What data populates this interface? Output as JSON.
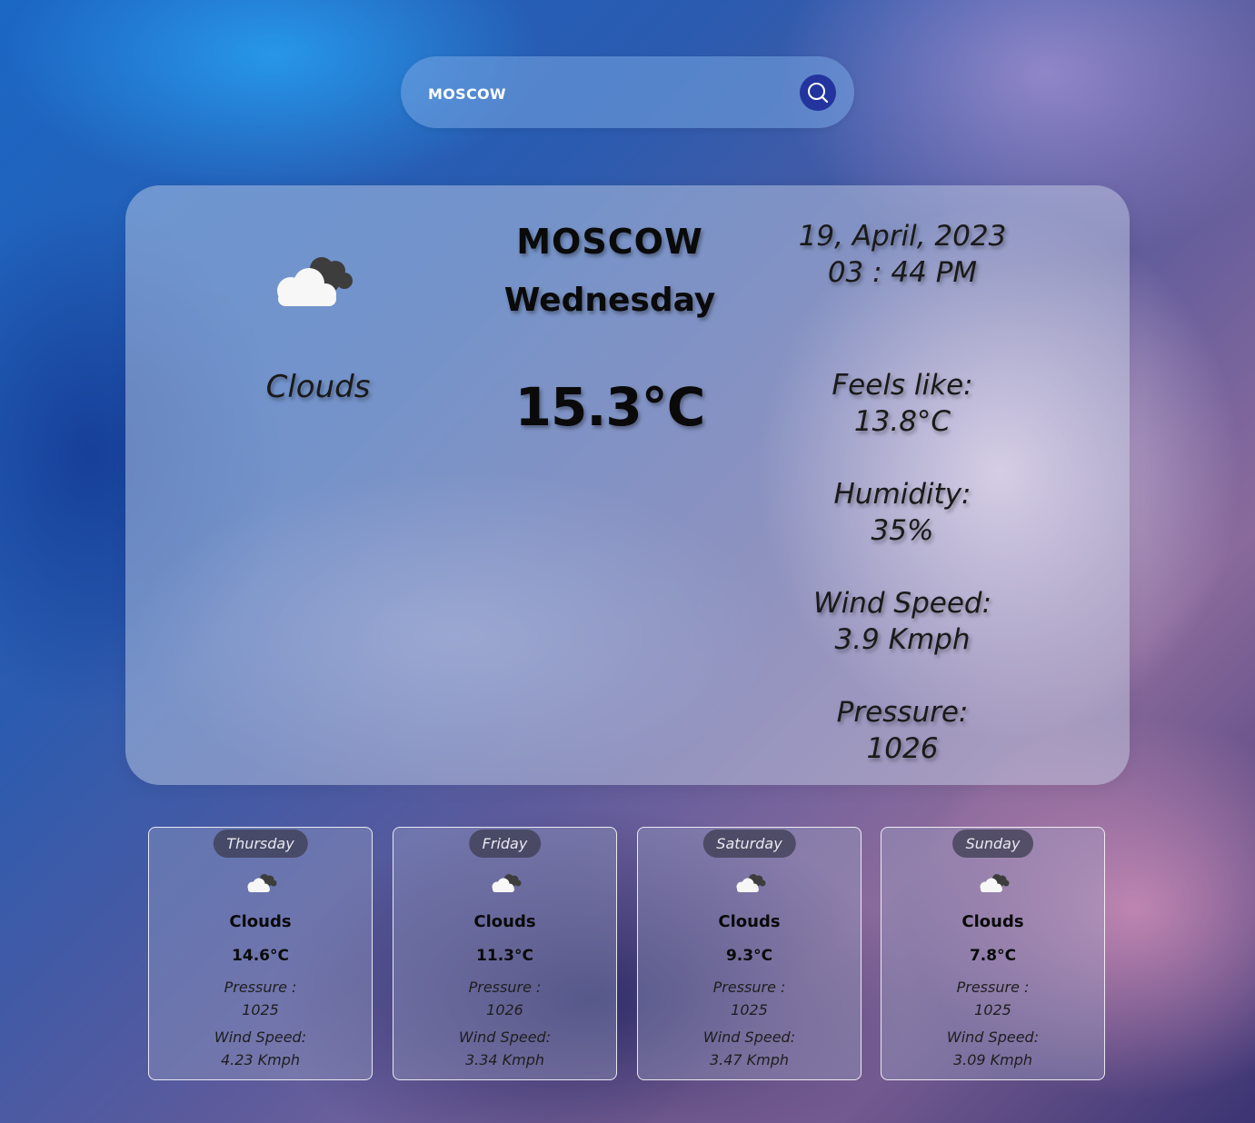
{
  "colors": {
    "search_bar_bg": "#78a5e1",
    "search_button": "#23349e",
    "text_dark": "#0a0a0a",
    "day_pill_bg": "#3c3c50"
  },
  "search": {
    "value": "MOSCOW",
    "placeholder": "Search city",
    "button_icon": "search-icon"
  },
  "current": {
    "icon": "clouds-icon",
    "condition": "Clouds",
    "city": "MOSCOW",
    "day": "Wednesday",
    "temperature": "15.3°C",
    "date": "19, April, 2023",
    "time": "03 : 44 PM",
    "stats": [
      {
        "label": "Feels like:",
        "value": "13.8°C"
      },
      {
        "label": "Humidity:",
        "value": "35%"
      },
      {
        "label": "Wind Speed:",
        "value": "3.9 Kmph"
      },
      {
        "label": "Pressure:",
        "value": "1026"
      }
    ]
  },
  "forecast": [
    {
      "day": "Thursday",
      "icon": "clouds-icon",
      "condition": "Clouds",
      "temperature": "14.6°C",
      "pressure_label": "Pressure :",
      "pressure": "1025",
      "wind_label": "Wind Speed:",
      "wind": "4.23 Kmph"
    },
    {
      "day": "Friday",
      "icon": "clouds-icon",
      "condition": "Clouds",
      "temperature": "11.3°C",
      "pressure_label": "Pressure :",
      "pressure": "1026",
      "wind_label": "Wind Speed:",
      "wind": "3.34 Kmph"
    },
    {
      "day": "Saturday",
      "icon": "clouds-icon",
      "condition": "Clouds",
      "temperature": "9.3°C",
      "pressure_label": "Pressure :",
      "pressure": "1025",
      "wind_label": "Wind Speed:",
      "wind": "3.47 Kmph"
    },
    {
      "day": "Sunday",
      "icon": "clouds-icon",
      "condition": "Clouds",
      "temperature": "7.8°C",
      "pressure_label": "Pressure :",
      "pressure": "1025",
      "wind_label": "Wind Speed:",
      "wind": "3.09 Kmph"
    }
  ]
}
